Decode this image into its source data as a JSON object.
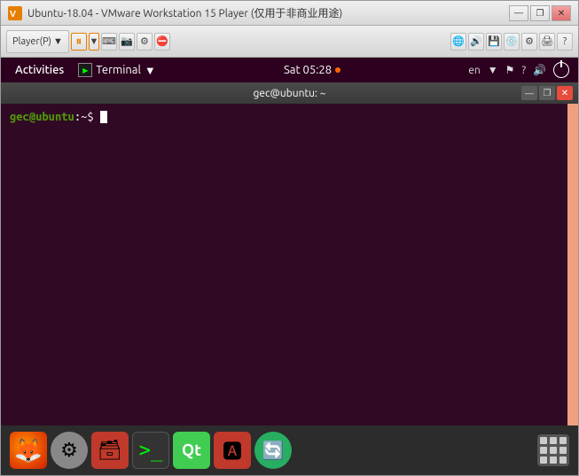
{
  "vmware": {
    "title": "Ubuntu-18.04 - VMware Workstation 15 Player (仅用于非商业用途)",
    "window_controls": {
      "minimize": "—",
      "restore": "❐",
      "close": "✕"
    },
    "toolbar": {
      "player_menu": "Player(P)",
      "player_dropdown": "▼"
    }
  },
  "ubuntu": {
    "topbar": {
      "activities": "Activities",
      "terminal_menu": "Terminal",
      "clock": "Sat 05:28",
      "lang": "en",
      "lang_dropdown": "▼"
    },
    "terminal": {
      "title": "gec@ubuntu: ~",
      "prompt": "gec@ubuntu",
      "path": ":~$"
    },
    "dock": {
      "apps_tooltip": "Show Applications"
    }
  }
}
